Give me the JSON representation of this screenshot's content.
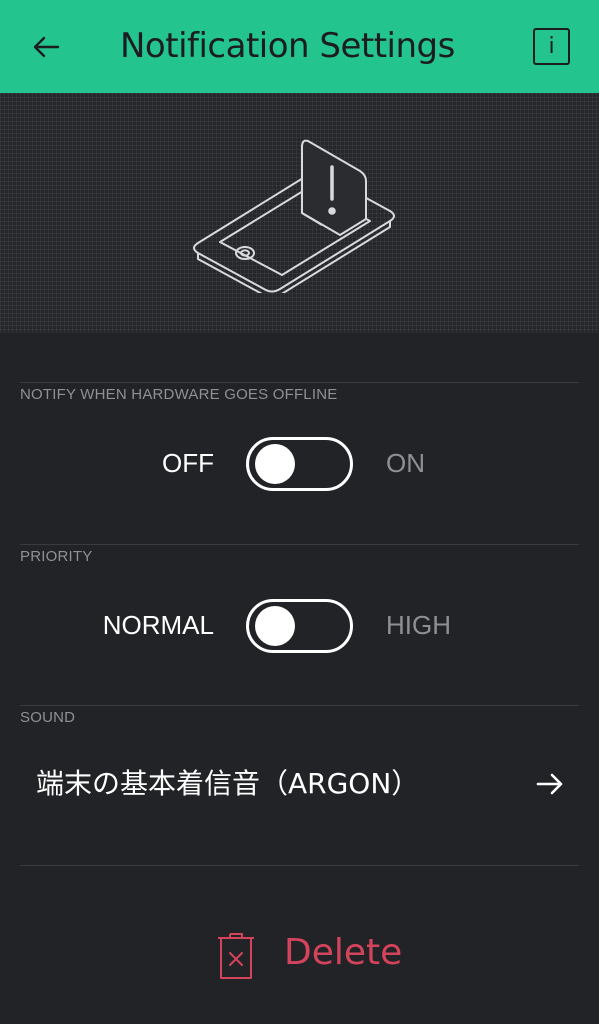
{
  "header": {
    "title": "Notification Settings",
    "back_icon": "arrow-left-icon",
    "info_label": "i",
    "background_color": "#23c48e"
  },
  "hero": {
    "illustration": "phone-notification-illustration"
  },
  "offline": {
    "label": "NOTIFY WHEN HARDWARE GOES OFFLINE",
    "off_label": "OFF",
    "on_label": "ON",
    "value": "OFF"
  },
  "priority": {
    "label": "PRIORITY",
    "normal_label": "NORMAL",
    "high_label": "HIGH",
    "value": "NORMAL"
  },
  "sound": {
    "label": "SOUND",
    "value": "端末の基本着信音（ARGON）",
    "arrow_icon": "arrow-right-icon"
  },
  "delete": {
    "label": "Delete",
    "icon": "trash-icon",
    "color": "#d3435c"
  }
}
